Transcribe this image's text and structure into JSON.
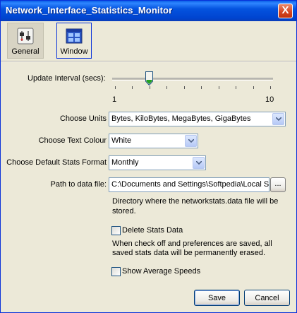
{
  "window": {
    "title": "Network_Interface_Statistics_Monitor",
    "close_label": "X"
  },
  "toolbar": {
    "general_label": "General",
    "window_label": "Window",
    "general_icon": "settings-panel-icon",
    "window_icon": "window-grid-icon"
  },
  "update_interval": {
    "label": "Update Interval (secs):",
    "min_label": "1",
    "max_label": "10",
    "value": 3,
    "min": 1,
    "max": 10
  },
  "units": {
    "label": "Choose Units",
    "value": "Bytes, KiloBytes, MegaBytes, GigaBytes"
  },
  "text_colour": {
    "label": "Choose Text Colour",
    "value": "White"
  },
  "stats_format": {
    "label": "Choose Default Stats Format",
    "value": "Monthly"
  },
  "data_path": {
    "label": "Path to data file:",
    "value": "C:\\Documents and Settings\\Softpedia\\Local S",
    "browse_label": "...",
    "help_line1": "Directory where the networkstats.data file will be",
    "help_line2": "stored."
  },
  "delete_stats": {
    "label": "Delete Stats Data",
    "checked": false,
    "help_line1": "When check off and preferences are saved, all",
    "help_line2": "saved stats data will be permanently erased."
  },
  "avg_speeds": {
    "label": "Show Average Speeds",
    "checked": false
  },
  "buttons": {
    "save": "Save",
    "cancel": "Cancel"
  },
  "colors": {
    "title_bar": "#0453df",
    "dialog_bg": "#ece9d8",
    "close_btn": "#d4421f"
  }
}
